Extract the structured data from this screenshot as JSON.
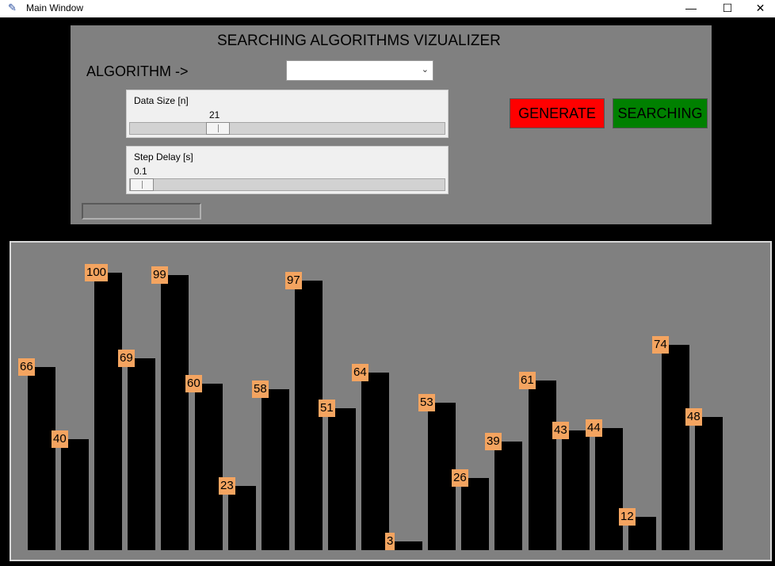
{
  "window": {
    "title": "Main Window",
    "minimize": "—",
    "maximize": "☐",
    "close": "✕",
    "icon": "feather-icon"
  },
  "panel": {
    "heading": "SEARCHING ALGORITHMS VIZUALIZER",
    "algorithm_label": "ALGORITHM ->",
    "algorithm_value": "",
    "data_size": {
      "label": "Data Size [n]",
      "value": "21",
      "fraction": 0.26
    },
    "step_delay": {
      "label": "Step Delay [s]",
      "value": "0.1",
      "fraction": 0.0
    },
    "generate_label": "GENERATE",
    "search_label": "SEARCHING",
    "colors": {
      "generate": "#ff0000",
      "search": "#008000",
      "panel": "#808080"
    }
  },
  "chart_data": {
    "type": "bar",
    "values": [
      66,
      40,
      100,
      69,
      99,
      60,
      23,
      58,
      97,
      51,
      64,
      3,
      53,
      26,
      39,
      61,
      43,
      44,
      12,
      74,
      48
    ],
    "ylim": [
      0,
      100
    ],
    "bar_color": "#000000",
    "label_color": "#f4a460",
    "background": "#808080"
  }
}
